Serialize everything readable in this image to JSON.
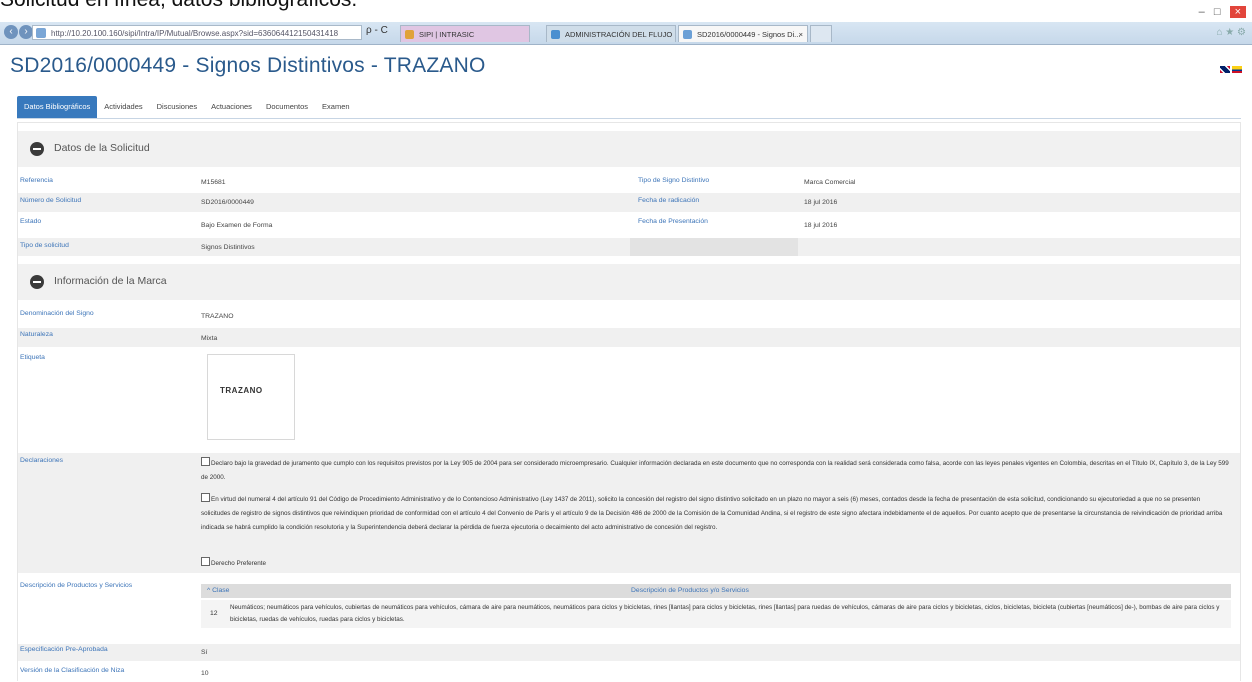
{
  "caption": "Solicitud en línea, datos bibliográficos.",
  "browser": {
    "url": "http://10.20.100.160/sipi/Intra/IP/Mutual/Browse.aspx?sid=636064412150431418",
    "search_glyph": "ρ - C",
    "tabs": [
      {
        "label": "SIPI | INTRASIC"
      },
      {
        "label": "ADMINISTRACIÓN DEL FLUJO ..."
      },
      {
        "label": "SD2016/0000449 - Signos Di..."
      }
    ],
    "close_glyph": "×",
    "minimize_glyph": "–",
    "maximize_glyph": "□",
    "window_close_glyph": "×",
    "fav_glyphs": "⌂ ★ ⚙"
  },
  "page": {
    "title": "SD2016/0000449 - Signos Distintivos - TRAZANO"
  },
  "tabs": [
    "Datos Bibliográficos",
    "Actividades",
    "Discusiones",
    "Actuaciones",
    "Documentos",
    "Examen"
  ],
  "solicitud": {
    "section_title": "Datos de la Solicitud",
    "rows": [
      {
        "label": "Referencia",
        "value": "M15681",
        "label2": "Tipo de Signo Distintivo",
        "value2": "Marca Comercial"
      },
      {
        "label": "Número de Solicitud",
        "value": "SD2016/0000449",
        "label2": "Fecha de radicación",
        "value2": "18 jul 2016"
      },
      {
        "label": "Estado",
        "value": "Bajo Examen de Forma",
        "label2": "Fecha de Presentación",
        "value2": "18 jul 2016"
      },
      {
        "label": "Tipo de solicitud",
        "value": "Signos Distintivos",
        "label2": "",
        "value2": ""
      }
    ]
  },
  "marca": {
    "section_title": "Información de la Marca",
    "denominacion_label": "Denominación del Signo",
    "denominacion_value": "TRAZANO",
    "naturaleza_label": "Naturaleza",
    "naturaleza_value": "Mixta",
    "etiqueta_label": "Etiqueta",
    "etiqueta_logo": "TRAZANO",
    "declaraciones_label": "Declaraciones",
    "declaracion_1": "Declaro bajo la gravedad de juramento que cumplo con los requisitos previstos por la Ley 905 de 2004 para ser considerado microempresario. Cualquier información declarada en este documento que no corresponda con la realidad será considerada como falsa, acorde con las leyes penales vigentes en Colombia, descritas en el Título IX, Capítulo 3, de la Ley 599 de 2000.",
    "declaracion_2": "En virtud del numeral 4 del artículo 91 del Código de Procedimiento Administrativo y de lo Contencioso Administrativo (Ley 1437 de 2011), solicito la concesión del registro del signo distintivo solicitado en un plazo no mayor a seis (6) meses, contados desde la fecha de presentación de esta solicitud, condicionando su ejecutoriedad a que no se presenten solicitudes de registro de signos distintivos que reivindiquen prioridad de conformidad con el artículo 4 del Convenio de París y el artículo 9 de la Decisión 486 de 2000 de la Comisión de la Comunidad Andina, si el registro de este signo afectara indebidamente el de aquellos. Por cuanto acepto que de presentarse la circunstancia de reivindicación de prioridad arriba indicada se habrá cumplido la condición resolutoria y la Superintendencia deberá declarar la pérdida de fuerza ejecutoria o decaimiento del acto administrativo de concesión del registro.",
    "derecho_preferente": "Derecho Preferente",
    "productos_label": "Descripción de Productos y Servicios",
    "table_headers": {
      "clase": "^ Clase",
      "descripcion": "Descripción de Productos y/o Servicios"
    },
    "table_rows": [
      {
        "clase": "12",
        "descripcion": "Neumáticos; neumáticos para vehículos, cubiertas de neumáticos para vehículos, cámara de aire para neumáticos, neumáticos para ciclos y bicicletas, rines [llantas] para ciclos y bicicletas, rines [llantas] para ruedas de vehículos, cámaras de aire para ciclos y bicicletas, ciclos, bicicletas, bicicleta (cubiertas [neumáticos] de-), bombas de aire para ciclos y bicicletas, ruedas de vehículos, ruedas para ciclos y bicicletas."
      }
    ],
    "especificacion_label": "Especificación Pre-Aprobada",
    "especificacion_value": "Sí",
    "version_label": "Versión de la Clasificación de Niza",
    "version_value": "10"
  },
  "colors": {
    "accent": "#3879bd",
    "label_blue": "#3c74b8",
    "title_blue": "#2a5a8c"
  }
}
